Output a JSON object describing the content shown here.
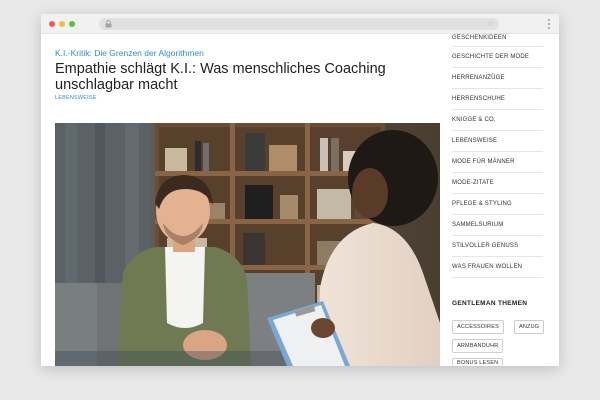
{
  "article": {
    "category": "K.I.-Kritik: Die Grenzen der Algorithmen",
    "title": "Empathie schlägt K.I.: Was menschliches Coaching unschlagbar macht",
    "tag": "LEBENSWEISE"
  },
  "sidebar": {
    "items": [
      "GESCHENKIDEEN",
      "GESCHICHTE DER MODE",
      "HERRENANZÜGE",
      "HERRENSCHUHE",
      "KNIGGE & CO.",
      "LEBENSWEISE",
      "MODE FÜR MÄNNER",
      "MODE-ZITATE",
      "PFLEGE & STYLING",
      "SAMMELSURIUM",
      "STILVOLLER GENUSS",
      "WAS FRAUEN WOLLEN"
    ],
    "section_title": "GENTLEMAN THEMEN",
    "pills": [
      "ACCESSOIRES",
      "ANZUG",
      "ARMBANDUHR",
      "BONUS LESEN"
    ]
  },
  "colors": {
    "accent": "#2f8fc8",
    "background": "#e9e9e9"
  }
}
